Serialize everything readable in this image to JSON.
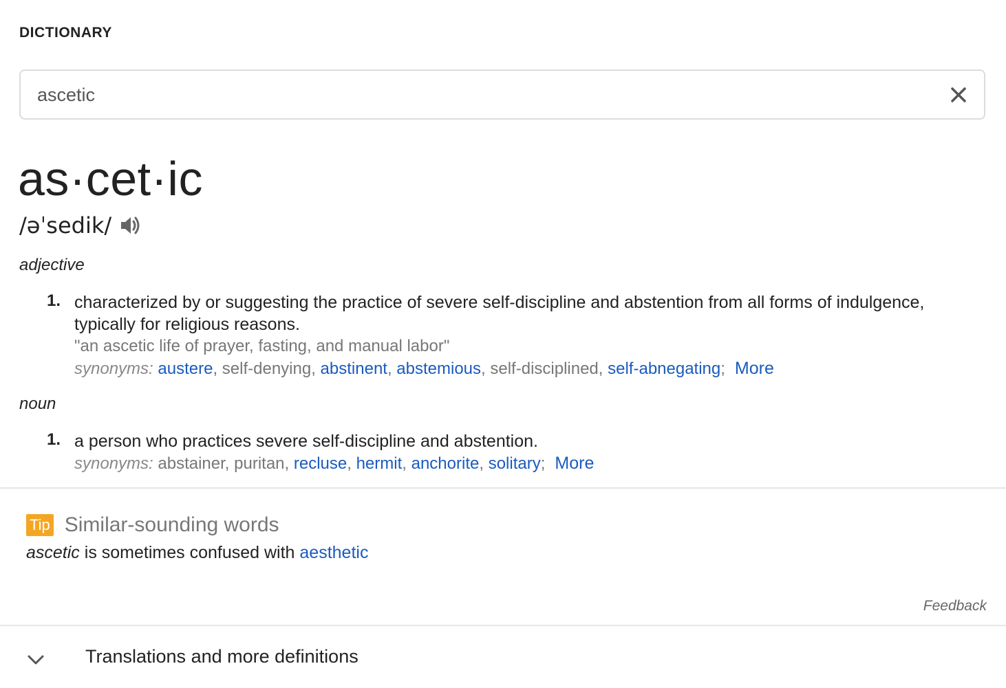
{
  "section_title": "DICTIONARY",
  "search": {
    "value": "ascetic",
    "placeholder": ""
  },
  "entry": {
    "headword": "as·cet·ic",
    "pronunciation": "/əˈsedik/",
    "senses": [
      {
        "pos": "adjective",
        "definitions": [
          {
            "number": "1.",
            "text": "characterized by or suggesting the practice of severe self-discipline and abstention from all forms of indulgence, typically for religious reasons.",
            "example": "\"an ascetic life of prayer, fasting, and manual labor\"",
            "synonyms_label": "synonyms:",
            "synonyms": [
              {
                "word": "austere",
                "link": true
              },
              {
                "word": "self-denying",
                "link": false
              },
              {
                "word": "abstinent",
                "link": true
              },
              {
                "word": "abstemious",
                "link": true
              },
              {
                "word": "self-disciplined",
                "link": false
              },
              {
                "word": "self-abnegating",
                "link": true
              }
            ],
            "more_label": "More"
          }
        ]
      },
      {
        "pos": "noun",
        "definitions": [
          {
            "number": "1.",
            "text": "a person who practices severe self-discipline and abstention.",
            "synonyms_label": "synonyms:",
            "synonyms": [
              {
                "word": "abstainer",
                "link": false
              },
              {
                "word": "puritan",
                "link": false
              },
              {
                "word": "recluse",
                "link": true
              },
              {
                "word": "hermit",
                "link": true
              },
              {
                "word": "anchorite",
                "link": true
              },
              {
                "word": "solitary",
                "link": true
              }
            ],
            "more_label": "More"
          }
        ]
      }
    ]
  },
  "tip": {
    "badge": "Tip",
    "heading": "Similar-sounding words",
    "word": "ascetic",
    "middle_text": " is sometimes confused with ",
    "link_word": "aesthetic"
  },
  "feedback_label": "Feedback",
  "expander": {
    "label": "Translations and more definitions"
  },
  "colors": {
    "link": "#1a5bbf",
    "tip_badge": "#f4a623",
    "muted_text": "#777777",
    "border": "#dadce0"
  }
}
